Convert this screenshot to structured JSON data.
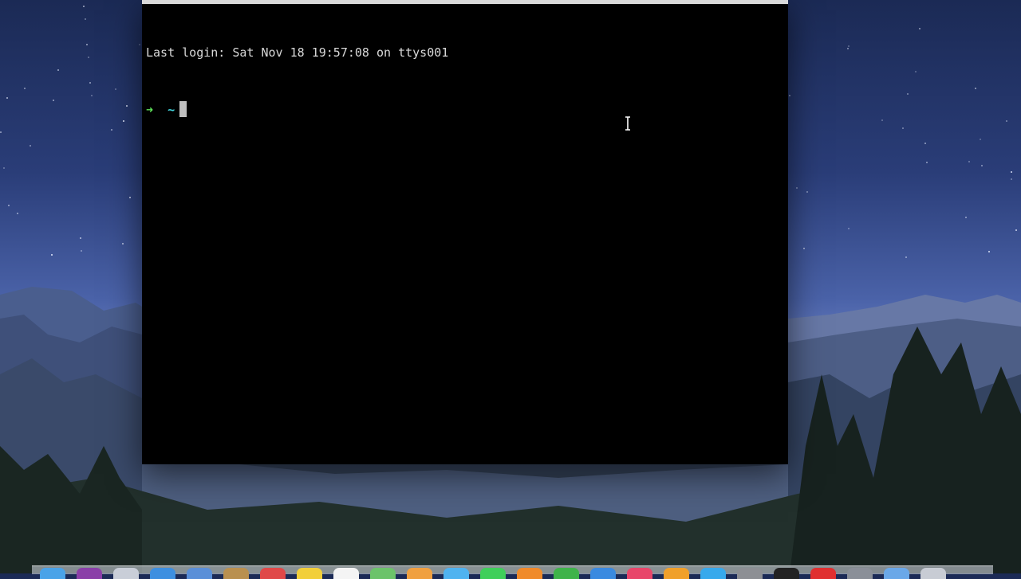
{
  "terminal": {
    "last_login_line": "Last login: Sat Nov 18 19:57:08 on ttys001",
    "prompt_arrow": "➜",
    "prompt_dir": "~"
  },
  "colors": {
    "terminal_bg": "#000000",
    "terminal_text": "#d9d9d9",
    "prompt_arrow": "#5fe35a",
    "prompt_dir": "#3fd0d8"
  },
  "dock": {
    "items": [
      {
        "icon": "finder-icon",
        "color": "#4aa3e8"
      },
      {
        "icon": "siri-icon",
        "color": "#8a3fa8"
      },
      {
        "icon": "launchpad-icon",
        "color": "#c9ced8"
      },
      {
        "icon": "safari-icon",
        "color": "#3d8fe0"
      },
      {
        "icon": "mail-icon",
        "color": "#5a8fd8"
      },
      {
        "icon": "contacts-icon",
        "color": "#b9904f"
      },
      {
        "icon": "calendar-icon",
        "color": "#e04848"
      },
      {
        "icon": "notes-icon",
        "color": "#f2cf3a"
      },
      {
        "icon": "reminders-icon",
        "color": "#f4f4f4"
      },
      {
        "icon": "maps-icon",
        "color": "#6cc36a"
      },
      {
        "icon": "photos-icon",
        "color": "#f0a040"
      },
      {
        "icon": "messages-icon",
        "color": "#4fb3f0"
      },
      {
        "icon": "facetime-icon",
        "color": "#3fcf5a"
      },
      {
        "icon": "ibooks-icon",
        "color": "#f08a2a"
      },
      {
        "icon": "numbers-icon",
        "color": "#3fb34a"
      },
      {
        "icon": "keynote-icon",
        "color": "#3a8ae0"
      },
      {
        "icon": "itunes-icon",
        "color": "#e8466a"
      },
      {
        "icon": "ibooks-store-icon",
        "color": "#f0a02a"
      },
      {
        "icon": "app-store-icon",
        "color": "#37a9ec"
      },
      {
        "icon": "system-preferences-icon",
        "color": "#8d8f94"
      },
      {
        "icon": "terminal-icon",
        "color": "#222222"
      },
      {
        "icon": "opera-icon",
        "color": "#e03030"
      },
      {
        "icon": "misc-app-icon",
        "color": "#8a8f98"
      },
      {
        "icon": "downloads-folder-icon",
        "color": "#6aa8e8"
      },
      {
        "icon": "trash-icon",
        "color": "#c8ccd4"
      }
    ]
  }
}
